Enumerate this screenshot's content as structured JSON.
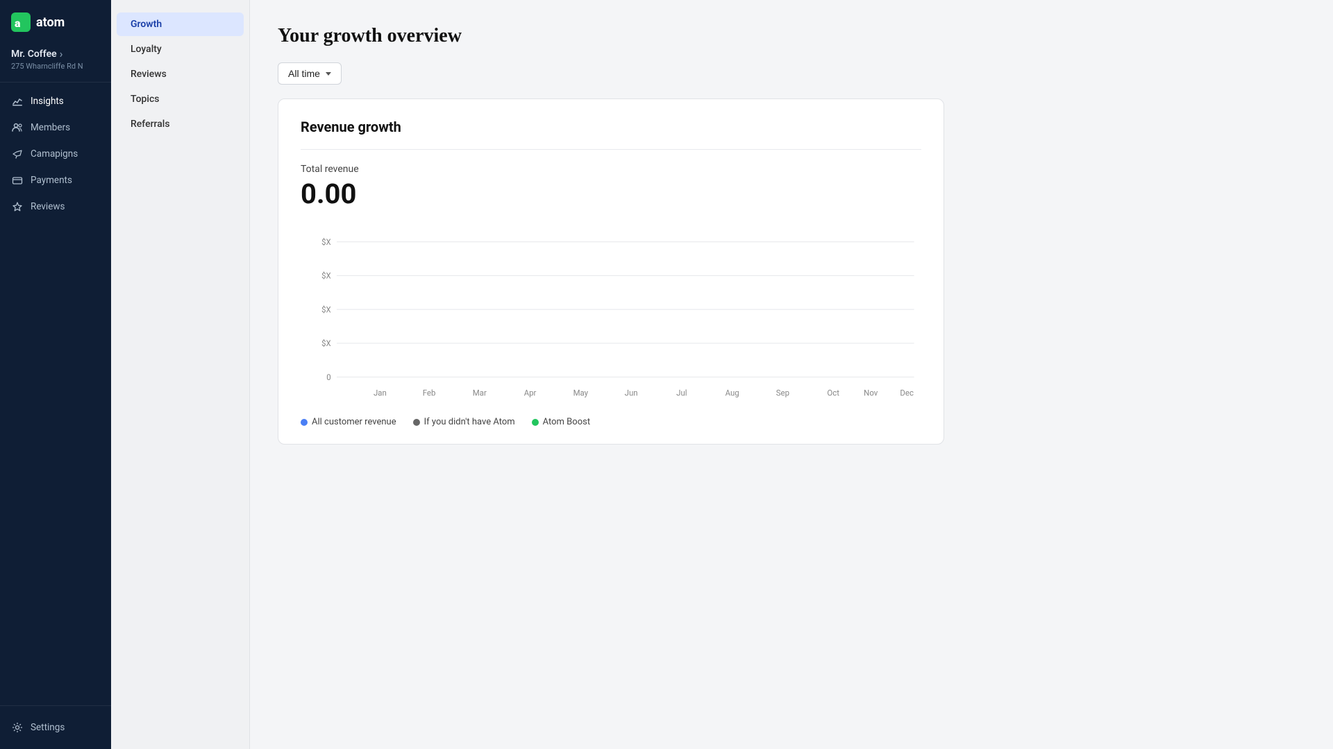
{
  "app": {
    "logo_text": "atom",
    "brand_name": "atom"
  },
  "account": {
    "name": "Mr. Coffee",
    "address": "275 Wharncliffe Rd N",
    "chevron": "›"
  },
  "sidebar": {
    "items": [
      {
        "id": "insights",
        "label": "Insights",
        "icon": "insights-icon",
        "active": true
      },
      {
        "id": "members",
        "label": "Members",
        "icon": "members-icon",
        "active": false
      },
      {
        "id": "campaigns",
        "label": "Camapigns",
        "icon": "campaigns-icon",
        "active": false
      },
      {
        "id": "payments",
        "label": "Payments",
        "icon": "payments-icon",
        "active": false
      },
      {
        "id": "reviews",
        "label": "Reviews",
        "icon": "reviews-icon",
        "active": false
      }
    ],
    "bottom_items": [
      {
        "id": "settings",
        "label": "Settings",
        "icon": "settings-icon"
      }
    ]
  },
  "subnav": {
    "items": [
      {
        "id": "growth",
        "label": "Growth",
        "active": true
      },
      {
        "id": "loyalty",
        "label": "Loyalty",
        "active": false
      },
      {
        "id": "reviews",
        "label": "Reviews",
        "active": false
      },
      {
        "id": "topics",
        "label": "Topics",
        "active": false
      },
      {
        "id": "referrals",
        "label": "Referrals",
        "active": false
      }
    ]
  },
  "page": {
    "title": "Your growth overview"
  },
  "filter": {
    "time_label": "All time"
  },
  "chart_card": {
    "title": "Revenue growth",
    "total_revenue_label": "Total revenue",
    "total_revenue_value": "0.00",
    "y_axis_labels": [
      "$X",
      "$X",
      "$X",
      "$X"
    ],
    "x_axis_labels": [
      "Jan",
      "Feb",
      "Mar",
      "Apr",
      "May",
      "Jun",
      "Jul",
      "Aug",
      "Sep",
      "Oct",
      "Nov",
      "Dec"
    ],
    "zero_label": "0",
    "legend": [
      {
        "id": "all-customer",
        "label": "All customer revenue",
        "color": "#4a7ff5"
      },
      {
        "id": "no-atom",
        "label": "If you didn't have Atom",
        "color": "#666"
      },
      {
        "id": "atom-boost",
        "label": "Atom Boost",
        "color": "#22c55e"
      }
    ]
  }
}
